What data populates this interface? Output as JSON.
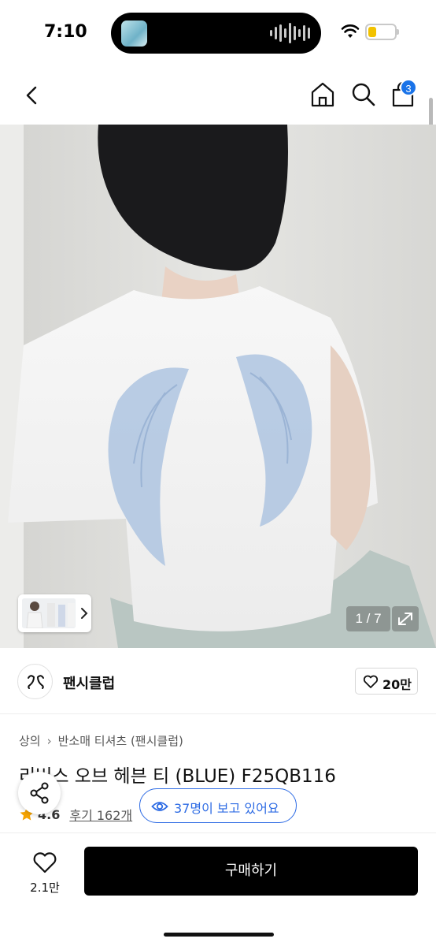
{
  "status_bar": {
    "time": "7:10",
    "battery_level": 0.3
  },
  "nav": {
    "cart_count": "3"
  },
  "gallery": {
    "counter": "1 / 7"
  },
  "brand": {
    "name": "팬시클럽",
    "likes": "20만"
  },
  "product": {
    "breadcrumb": [
      "상의",
      "반소매 티셔츠 (팬시클럽)"
    ],
    "title": "리버스 오브 헤븐 티 (BLUE) F25QB116",
    "rating": "4.6",
    "reviews": "후기 162개",
    "viewers": "37명이 보고 있어요",
    "rating_stars": 1
  },
  "bottom": {
    "wish_count": "2.1만",
    "buy_label": "구매하기"
  },
  "colors": {
    "accent": "#2d6be4",
    "badge": "#1a73e8",
    "star": "#f5a300",
    "buy_bg": "#000000"
  },
  "icons": [
    "back-icon",
    "home-icon",
    "search-icon",
    "cart-icon",
    "expand-icon",
    "heart-icon",
    "eye-icon",
    "share-icon",
    "star-icon",
    "wifi-icon",
    "battery-icon"
  ]
}
